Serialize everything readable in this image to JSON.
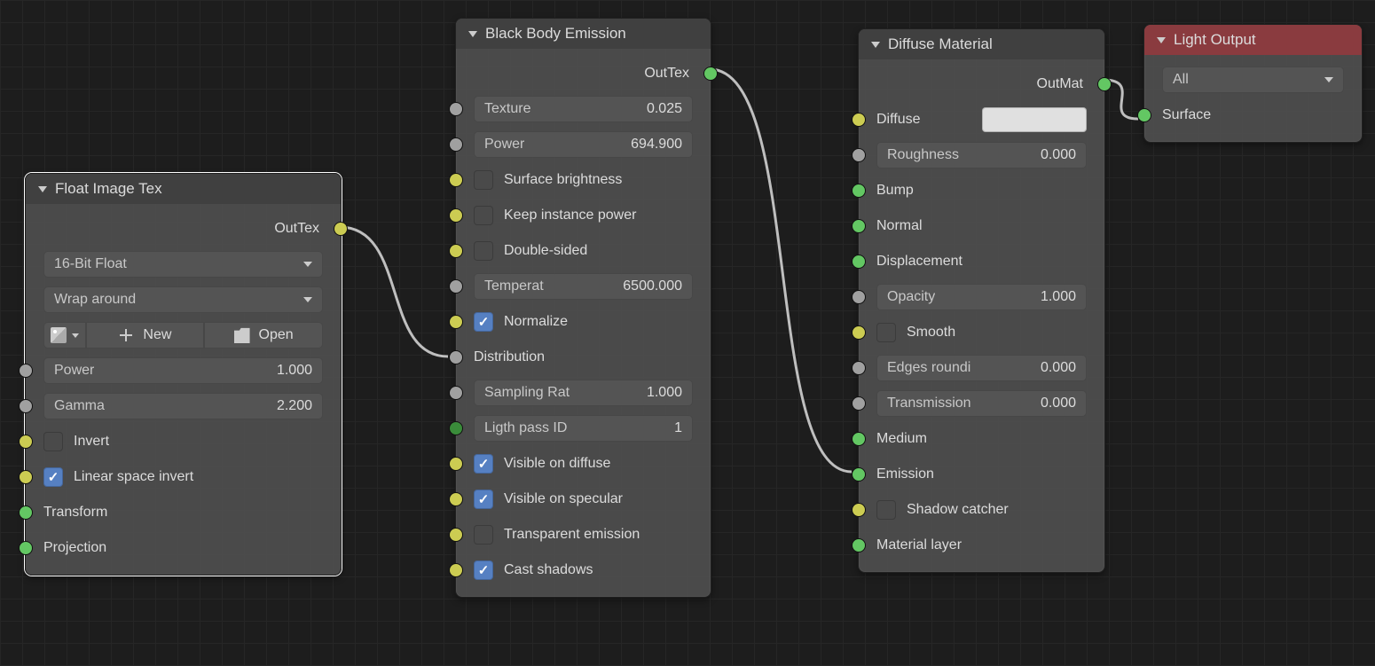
{
  "nodes": {
    "floatImageTex": {
      "title": "Float Image Tex",
      "outTex": "OutTex",
      "bitDepth": "16-Bit Float",
      "wrap": "Wrap around",
      "newLabel": "New",
      "openLabel": "Open",
      "power": {
        "label": "Power",
        "value": "1.000"
      },
      "gamma": {
        "label": "Gamma",
        "value": "2.200"
      },
      "invert": "Invert",
      "linearSpaceInvert": "Linear space invert",
      "transform": "Transform",
      "projection": "Projection"
    },
    "blackBody": {
      "title": "Black Body Emission",
      "outTex": "OutTex",
      "texture": {
        "label": "Texture",
        "value": "0.025"
      },
      "power": {
        "label": "Power",
        "value": "694.900"
      },
      "surfaceBrightness": "Surface brightness",
      "keepInstancePower": "Keep instance power",
      "doubleSided": "Double-sided",
      "temperature": {
        "label": "Temperat",
        "value": "6500.000"
      },
      "normalize": "Normalize",
      "distribution": "Distribution",
      "samplingRate": {
        "label": "Sampling Rat",
        "value": "1.000"
      },
      "lightPassId": {
        "label": "Ligth pass ID",
        "value": "1"
      },
      "visibleOnDiffuse": "Visible on diffuse",
      "visibleOnSpecular": "Visible on specular",
      "transparentEmission": "Transparent emission",
      "castShadows": "Cast shadows"
    },
    "diffuse": {
      "title": "Diffuse Material",
      "outMat": "OutMat",
      "diffuse": "Diffuse",
      "roughness": {
        "label": "Roughness",
        "value": "0.000"
      },
      "bump": "Bump",
      "normal": "Normal",
      "displacement": "Displacement",
      "opacity": {
        "label": "Opacity",
        "value": "1.000"
      },
      "smooth": "Smooth",
      "edgesRounding": {
        "label": "Edges roundi",
        "value": "0.000"
      },
      "transmission": {
        "label": "Transmission",
        "value": "0.000"
      },
      "medium": "Medium",
      "emission": "Emission",
      "shadowCatcher": "Shadow catcher",
      "materialLayer": "Material layer"
    },
    "lightOutput": {
      "title": "Light Output",
      "target": "All",
      "surface": "Surface"
    }
  }
}
